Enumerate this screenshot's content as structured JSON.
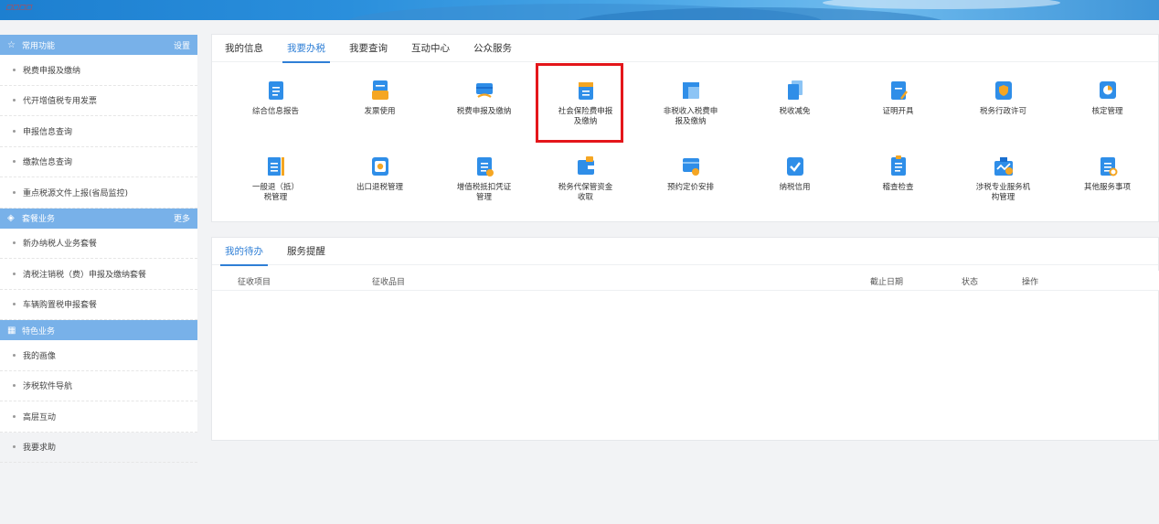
{
  "sidebar": {
    "sections": [
      {
        "title": "常用功能",
        "action": "设置",
        "icon": "star-icon",
        "items": [
          "税费申报及缴纳",
          "代开增值税专用发票",
          "申报信息查询",
          "缴款信息查询",
          "重点税源文件上报(省局监控)"
        ]
      },
      {
        "title": "套餐业务",
        "action": "更多",
        "icon": "layers-icon",
        "items": [
          "新办纳税人业务套餐",
          "清税注销税（费）申报及缴纳套餐",
          "车辆购置税申报套餐"
        ]
      },
      {
        "title": "特色业务",
        "action": "",
        "icon": "grid-icon",
        "items": [
          "我的画像",
          "涉税软件导航",
          "高层互动"
        ]
      }
    ],
    "extra_item": "我要求助"
  },
  "main_tabs": [
    "我的信息",
    "我要办税",
    "我要查询",
    "互动中心",
    "公众服务"
  ],
  "active_main_tab": 1,
  "services": [
    {
      "label": "综合信息报告",
      "icon": "document-list-icon"
    },
    {
      "label": "发票使用",
      "icon": "invoice-icon"
    },
    {
      "label": "税费申报及缴纳",
      "icon": "card-payment-icon"
    },
    {
      "label": "社会保险费申报及缴纳",
      "icon": "calendar-doc-icon"
    },
    {
      "label": "非税收入税费申报及缴纳",
      "icon": "layout-icon"
    },
    {
      "label": "税收减免",
      "icon": "copy-doc-icon"
    },
    {
      "label": "证明开具",
      "icon": "certificate-pen-icon"
    },
    {
      "label": "税务行政许可",
      "icon": "shield-icon"
    },
    {
      "label": "核定管理",
      "icon": "pie-chart-icon"
    },
    {
      "label": "一般退（抵）税管理",
      "icon": "list-bar-icon"
    },
    {
      "label": "出口退税管理",
      "icon": "gear-box-icon"
    },
    {
      "label": "增值税抵扣凭证管理",
      "icon": "doc-coin-icon"
    },
    {
      "label": "税务代保管资金收取",
      "icon": "wallet-icon"
    },
    {
      "label": "预约定价安排",
      "icon": "clock-card-icon"
    },
    {
      "label": "纳税信用",
      "icon": "check-box-icon"
    },
    {
      "label": "稽查检查",
      "icon": "clipboard-icon"
    },
    {
      "label": "涉税专业服务机构管理",
      "icon": "briefcase-chart-icon"
    },
    {
      "label": "其他服务事项",
      "icon": "search-doc-icon"
    }
  ],
  "highlighted_service": "社会保险费申报及缴纳",
  "bottom_tabs": [
    "我的待办",
    "服务提醒"
  ],
  "table_headers": [
    "征收项目",
    "征收品目",
    "截止日期",
    "状态",
    "操作"
  ],
  "colors": {
    "accent": "#2f7fd6",
    "sidebar_header": "#78b1e9",
    "highlight": "#e4161a"
  }
}
